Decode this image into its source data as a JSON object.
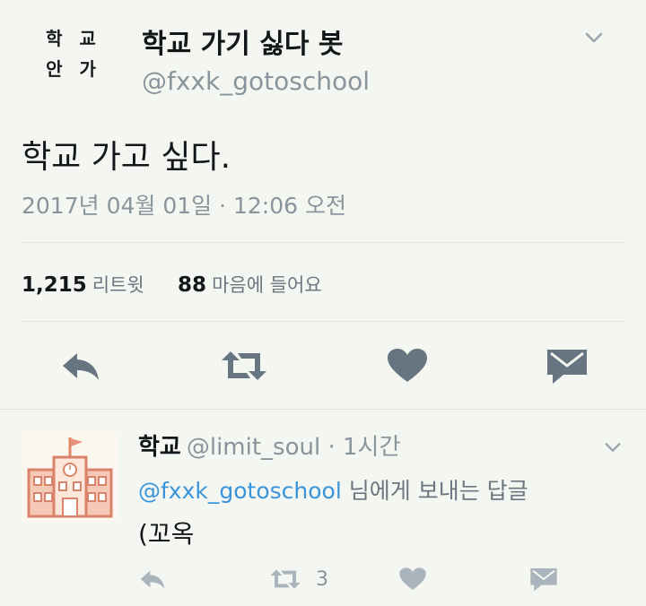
{
  "tweet": {
    "avatar_text_line1": "학 교",
    "avatar_text_line2": "안 가",
    "display_name": "학교 가기 싫다 봇",
    "handle": "@fxxk_gotoschool",
    "text": "학교 가고 싶다.",
    "timestamp": "2017년 04월 01일 · 12:06 오전",
    "retweet_count": "1,215",
    "retweet_label": "리트윗",
    "like_count": "88",
    "like_label": "마음에 들어요"
  },
  "reply": {
    "name": "학교",
    "meta": "@limit_soul · 1시간",
    "reply_prefix_mention": "@fxxk_gotoschool",
    "reply_suffix": "님에게 보내는 답글",
    "text": "(꼬옥",
    "retweet_count": "3"
  },
  "icons": [
    "chevron-down-icon",
    "reply-icon",
    "retweet-icon",
    "heart-icon",
    "dm-icon",
    "school-avatar"
  ],
  "colors": {
    "background": "#f4f7f1",
    "icon": "#66757f",
    "mention": "#3b94d9",
    "text": "#14171a"
  }
}
